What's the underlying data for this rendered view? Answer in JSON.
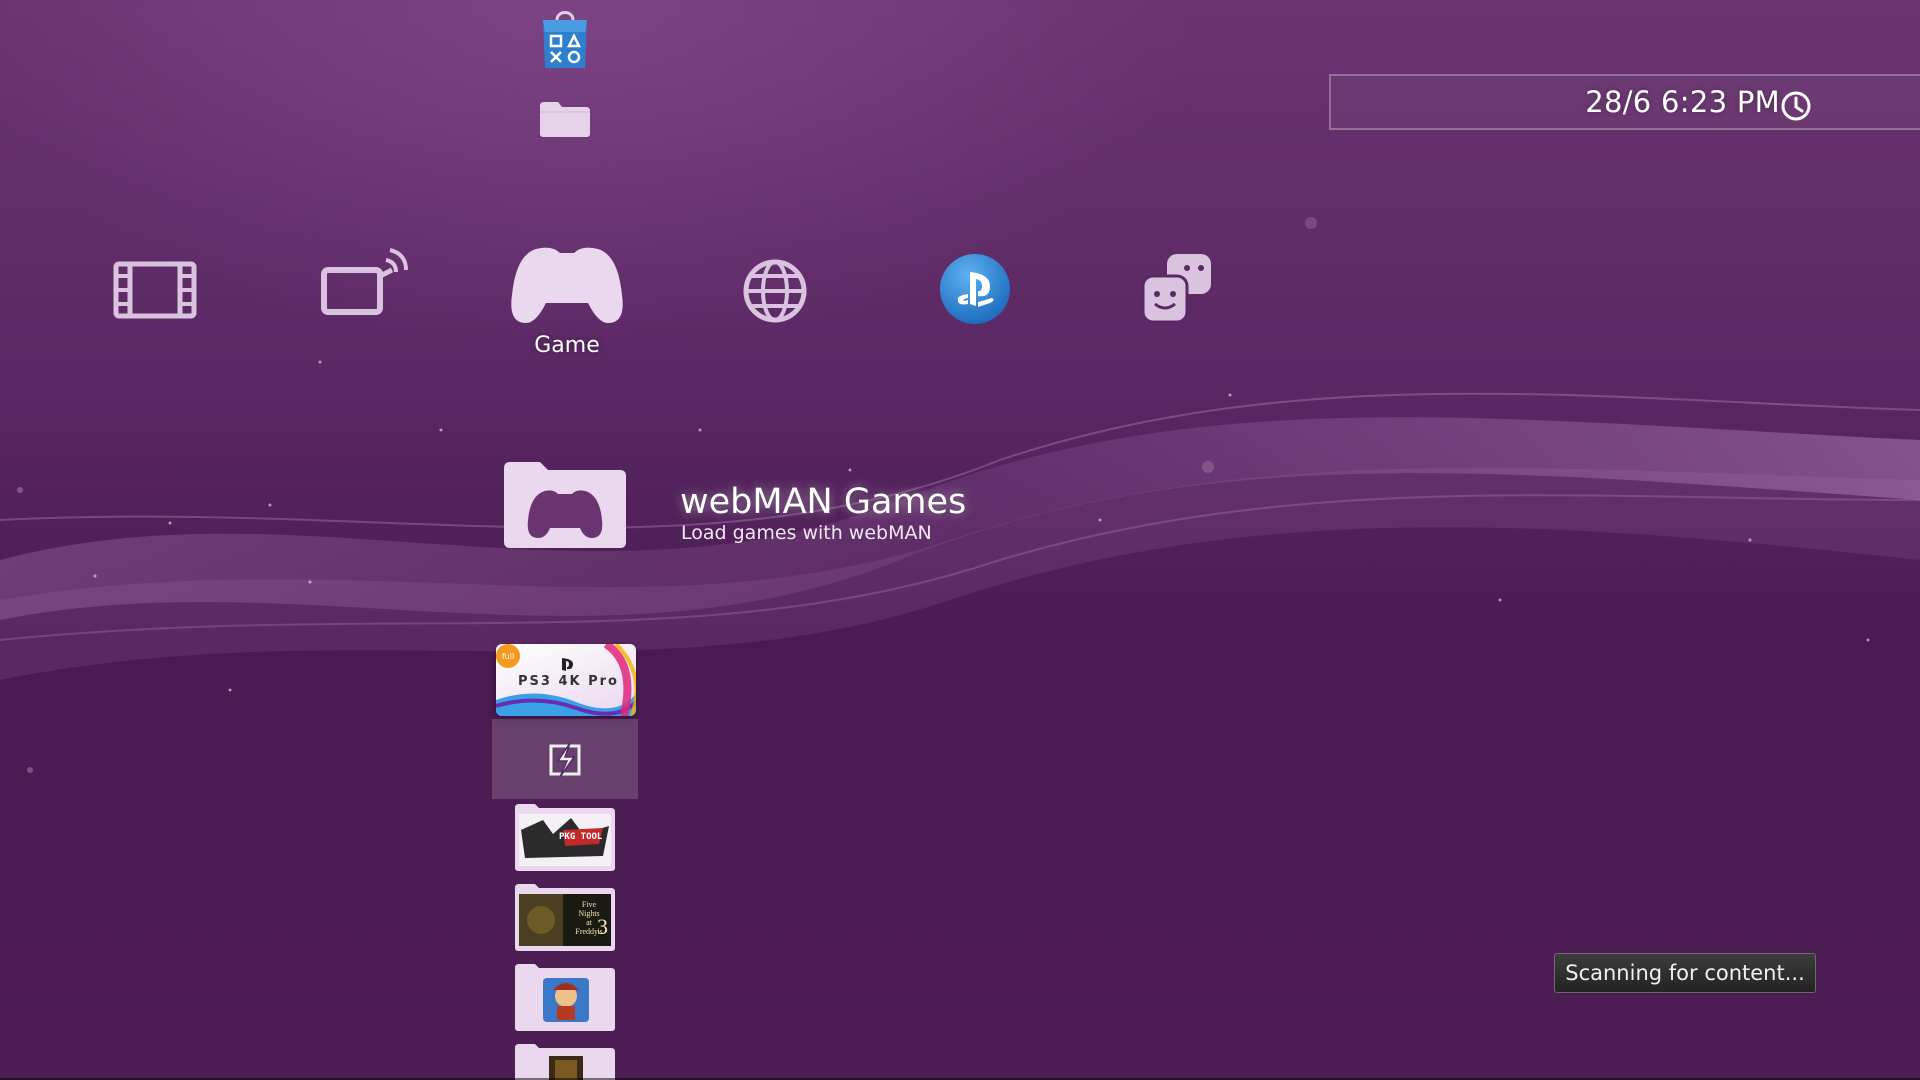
{
  "clock": {
    "datetime": "28/6 6:23 PM"
  },
  "categories": [
    {
      "name": "video",
      "icon": "film-icon",
      "label": ""
    },
    {
      "name": "tv",
      "icon": "tv-broadcast-icon",
      "label": ""
    },
    {
      "name": "game",
      "icon": "gamepad-icon",
      "label": "Game"
    },
    {
      "name": "network",
      "icon": "globe-icon",
      "label": ""
    },
    {
      "name": "psn",
      "icon": "playstation-network-icon",
      "label": ""
    },
    {
      "name": "friends",
      "icon": "friends-icon",
      "label": ""
    }
  ],
  "column_above": [
    {
      "icon": "playstation-store-icon"
    },
    {
      "icon": "folder-icon"
    }
  ],
  "selected": {
    "icon": "game-folder-icon",
    "title": "webMAN Games",
    "subtitle": "Load games with webMAN"
  },
  "list_below": [
    {
      "icon": "ps3-4k-pro-theme-thumbnail",
      "tile_text": "PS3 4K Pro",
      "badge_text": "full"
    },
    {
      "icon": "webman-lightning-icon"
    },
    {
      "icon": "pkg-tool-thumbnail",
      "tile_text": "PKG TOOL"
    },
    {
      "icon": "five-nights-at-freddys-3-thumbnail",
      "tile_lines": [
        "Five",
        "Nights",
        "at",
        "Freddy's"
      ],
      "tile_num": "3"
    },
    {
      "icon": "game-character-thumbnail"
    },
    {
      "icon": "game-thumbnail-partial"
    }
  ],
  "toast": {
    "text": "Scanning for content..."
  },
  "colors": {
    "bg_top": "#6a3470",
    "bg_bottom": "#4a1b52",
    "psn_blue": "#1f7fd4",
    "icon_tint": "#e6d3ea"
  }
}
